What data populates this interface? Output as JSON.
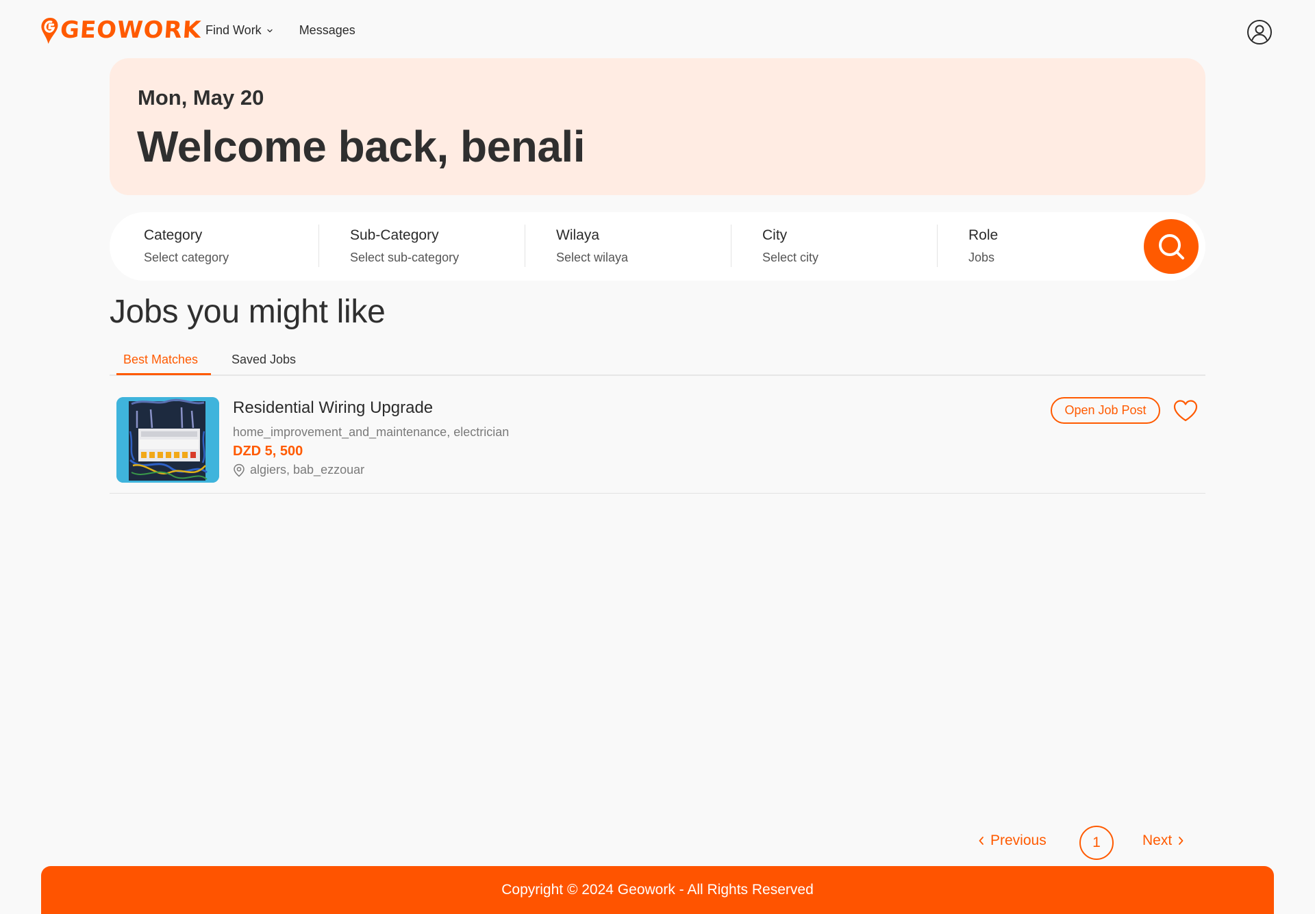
{
  "header": {
    "logo_text": "GEOWORK",
    "nav": {
      "find_work": "Find Work",
      "messages": "Messages"
    }
  },
  "welcome": {
    "date": "Mon, May 20",
    "greeting": "Welcome back, benali"
  },
  "search": {
    "filters": [
      {
        "label": "Category",
        "value": "Select category"
      },
      {
        "label": "Sub-Category",
        "value": "Select sub-category"
      },
      {
        "label": "Wilaya",
        "value": "Select wilaya"
      },
      {
        "label": "City",
        "value": "Select city"
      },
      {
        "label": "Role",
        "value": "Jobs"
      }
    ]
  },
  "jobs_section": {
    "title": "Jobs you might like",
    "tabs": [
      "Best Matches",
      "Saved Jobs"
    ],
    "active_tab": "Best Matches"
  },
  "jobs": [
    {
      "title": "Residential Wiring Upgrade",
      "categories": "home_improvement_and_maintenance, electrician",
      "price": "DZD 5, 500",
      "location": "algiers, bab_ezzouar",
      "open_label": "Open Job Post",
      "saved": false
    }
  ],
  "pagination": {
    "previous_label": "Previous",
    "current_page": "1",
    "next_label": "Next"
  },
  "footer": {
    "text": "Copyright © 2024 Geowork - All Rights Reserved"
  },
  "colors": {
    "accent": "#ff5a00",
    "welcome_bg": "#ffece3",
    "page_bg": "#f9f9f9",
    "text_dark": "#2f2f2f",
    "text_muted": "#7a7a7a"
  }
}
